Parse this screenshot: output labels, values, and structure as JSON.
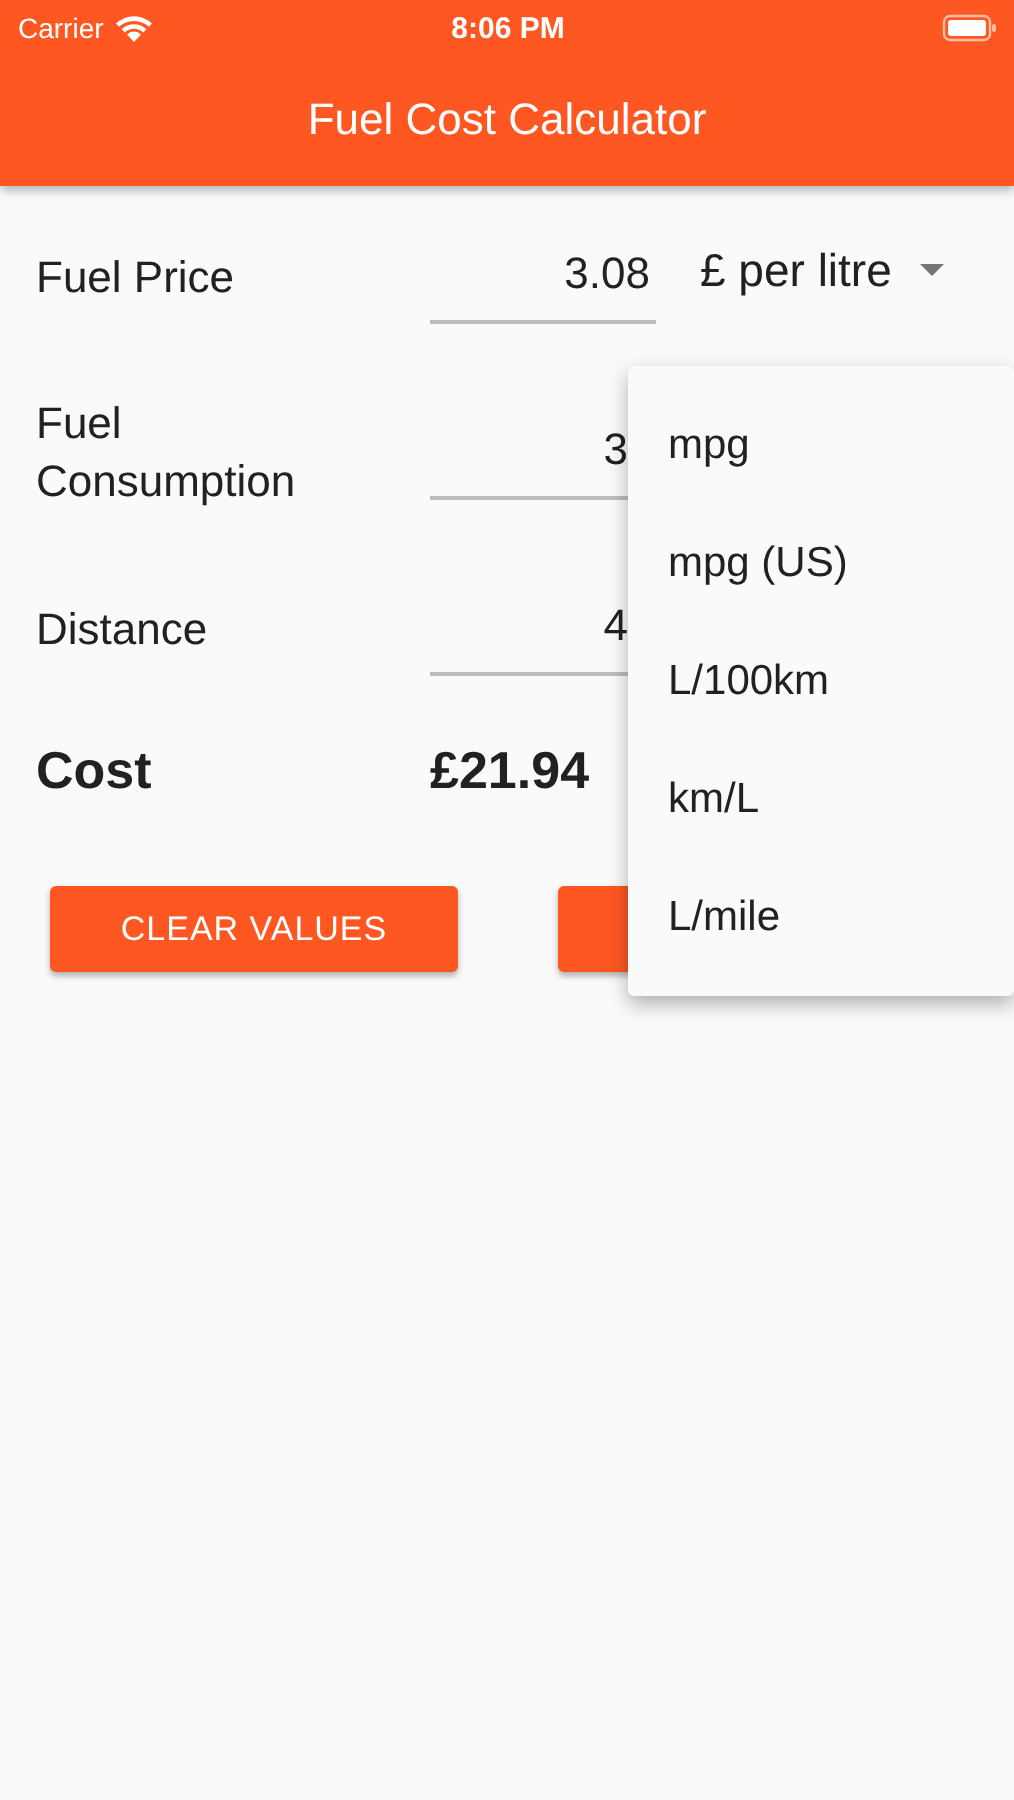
{
  "status_bar": {
    "carrier": "Carrier",
    "time": "8:06 PM"
  },
  "app_bar": {
    "title": "Fuel Cost Calculator"
  },
  "fields": [
    {
      "label": "Fuel Price",
      "value": "3.08",
      "unit": "£ per litre"
    },
    {
      "label": "Fuel Consumption",
      "value": "3"
    },
    {
      "label": "Distance",
      "value": "4"
    }
  ],
  "result": {
    "label": "Cost",
    "value": "£21.94"
  },
  "buttons": [
    {
      "label": "CLEAR VALUES",
      "kind": "raised"
    },
    {
      "kind": "raised"
    }
  ],
  "unit_menu": {
    "open": true,
    "items": [
      {
        "label": "mpg"
      },
      {
        "label": "mpg (US)"
      },
      {
        "label": "L/100km"
      },
      {
        "label": "km/L"
      },
      {
        "label": "L/mile"
      }
    ]
  }
}
